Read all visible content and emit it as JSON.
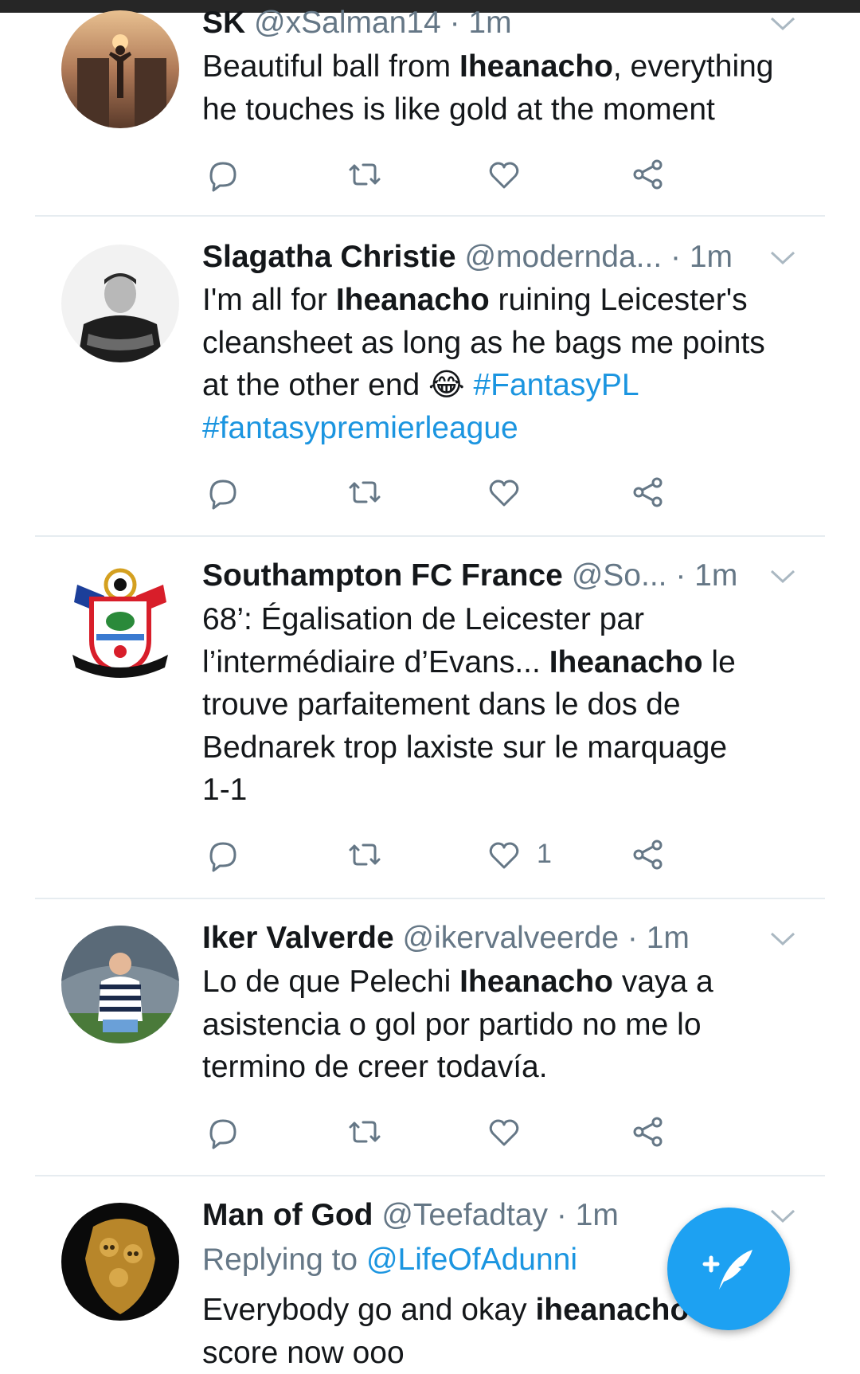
{
  "tweets": [
    {
      "name": "SK",
      "handle": "@xSalman14",
      "time": "· 1m",
      "lines": [
        [
          {
            "t": "Beautiful ball from "
          },
          {
            "t": "Iheanacho",
            "b": true
          },
          {
            "t": ", everything"
          }
        ],
        [
          {
            "t": "he touches is like gold at the moment"
          }
        ]
      ],
      "likes": ""
    },
    {
      "name": "Slagatha Christie",
      "handle": "@modernda...",
      "time": "· 1m",
      "lines": [
        [
          {
            "t": "I'm all for "
          },
          {
            "t": "Iheanacho",
            "b": true
          },
          {
            "t": " ruining Leicester's"
          }
        ],
        [
          {
            "t": "cleansheet as long as he bags me points"
          }
        ],
        [
          {
            "t": "at the other end 😂 "
          },
          {
            "t": "#FantasyPL",
            "tag": true
          }
        ],
        [
          {
            "t": "#fantasypremierleague",
            "tag": true
          }
        ]
      ],
      "likes": ""
    },
    {
      "name": "Southampton FC France",
      "handle": "@So...",
      "time": "· 1m",
      "lines": [
        [
          {
            "t": "68’: Égalisation de Leicester par"
          }
        ],
        [
          {
            "t": "l’intermédiaire d’Evans... "
          },
          {
            "t": "Iheanacho",
            "b": true
          },
          {
            "t": " le"
          }
        ],
        [
          {
            "t": "trouve parfaitement dans le dos de"
          }
        ],
        [
          {
            "t": "Bednarek trop laxiste sur le marquage"
          }
        ],
        [
          {
            "t": "1-1"
          }
        ]
      ],
      "likes": "1"
    },
    {
      "name": "Iker Valverde",
      "handle": "@ikervalveerde",
      "time": "· 1m",
      "lines": [
        [
          {
            "t": "Lo de que Pelechi "
          },
          {
            "t": "Iheanacho",
            "b": true
          },
          {
            "t": " vaya a"
          }
        ],
        [
          {
            "t": "asistencia o gol por partido no me lo"
          }
        ],
        [
          {
            "t": "termino de creer todavía."
          }
        ]
      ],
      "likes": ""
    },
    {
      "name": "Man of God",
      "handle": "@Teefadtay",
      "time": "· 1m",
      "replying_prefix": "Replying to ",
      "replying_to": "@LifeOfAdunni",
      "lines": [
        [
          {
            "t": "Everybody go and okay "
          },
          {
            "t": "iheanacho",
            "b": true
          }
        ],
        [
          {
            "t": "score now ooo"
          }
        ]
      ],
      "likes": ""
    }
  ],
  "icons": {
    "reply": "reply-icon",
    "retweet": "retweet-icon",
    "like": "heart-icon",
    "share": "share-icon",
    "menu": "chevron-down-icon",
    "compose": "compose-tweet-icon"
  },
  "colors": {
    "accent": "#1da1f2",
    "link": "#1b95e0",
    "secondary_text": "#657786",
    "divider": "#e6ecf0"
  }
}
